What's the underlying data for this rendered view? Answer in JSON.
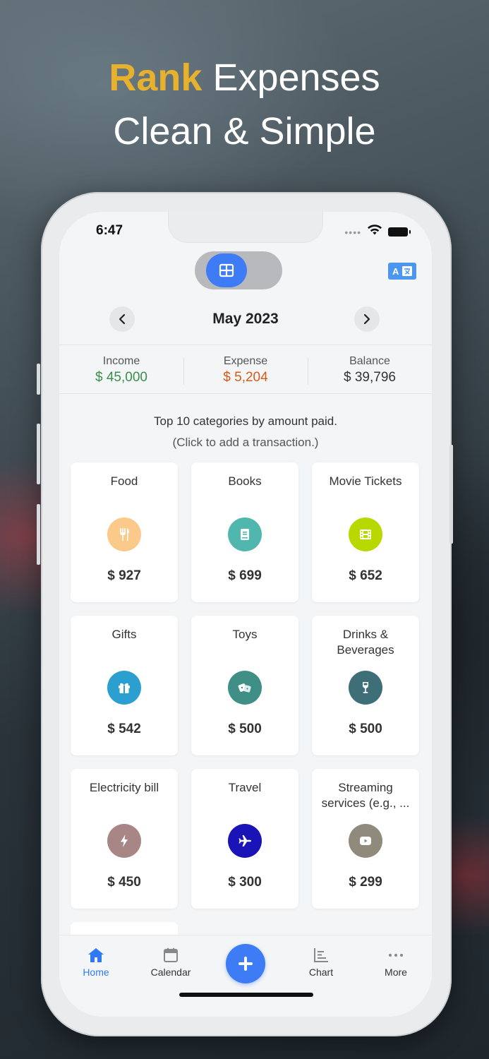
{
  "headline": {
    "accent": "Rank",
    "line1_rest": " Expenses",
    "line2": "Clean & Simple"
  },
  "status_bar": {
    "time": "6:47",
    "icons": [
      "signal-dots-icon",
      "wifi-icon",
      "battery-icon"
    ]
  },
  "view_toggle": {
    "options": [
      "list-view-icon",
      "grid-view-icon"
    ],
    "selected": "grid-view-icon"
  },
  "language_button_icon": "translate-icon",
  "month_nav": {
    "label": "May 2023",
    "prev_icon": "chevron-left-icon",
    "next_icon": "chevron-right-icon"
  },
  "summary": {
    "income": {
      "title": "Income",
      "value": "$ 45,000",
      "color": "#3a8d4a"
    },
    "expense": {
      "title": "Expense",
      "value": "$ 5,204",
      "color": "#d55a1c"
    },
    "balance": {
      "title": "Balance",
      "value": "$ 39,796"
    }
  },
  "description": {
    "line1": "Top 10 categories by amount paid.",
    "line2": "(Click to add a transaction.)"
  },
  "categories": [
    {
      "name": "Food",
      "amount": "$ 927",
      "icon": "fork-knife-icon",
      "color": "#fbc98a"
    },
    {
      "name": "Books",
      "amount": "$ 699",
      "icon": "book-icon",
      "color": "#4fb7ae"
    },
    {
      "name": "Movie Tickets",
      "amount": "$ 652",
      "icon": "film-icon",
      "color": "#b9d800"
    },
    {
      "name": "Gifts",
      "amount": "$ 542",
      "icon": "gift-icon",
      "color": "#2b9fd0"
    },
    {
      "name": "Toys",
      "amount": "$ 500",
      "icon": "dice-icon",
      "color": "#3f8f86"
    },
    {
      "name": "Drinks & Beverages",
      "amount": "$ 500",
      "icon": "wine-glass-icon",
      "color": "#3e6f78"
    },
    {
      "name": "Electricity bill",
      "amount": "$ 450",
      "icon": "lightning-icon",
      "color": "#a88686"
    },
    {
      "name": "Travel",
      "amount": "$ 300",
      "icon": "airplane-icon",
      "color": "#1a14b8"
    },
    {
      "name": "Streaming services (e.g., ...",
      "amount": "$ 299",
      "icon": "play-button-icon",
      "color": "#8f8a7c"
    }
  ],
  "tabbar": {
    "items": [
      {
        "label": "Home",
        "icon": "home-icon",
        "active": true
      },
      {
        "label": "Calendar",
        "icon": "calendar-icon",
        "active": false
      },
      {
        "label": "Chart",
        "icon": "chart-icon",
        "active": false
      },
      {
        "label": "More",
        "icon": "more-dots-icon",
        "active": false
      }
    ],
    "add_icon": "plus-icon"
  },
  "colors": {
    "accent_blue": "#3d7cf4",
    "headline_accent": "#e7b12e"
  }
}
